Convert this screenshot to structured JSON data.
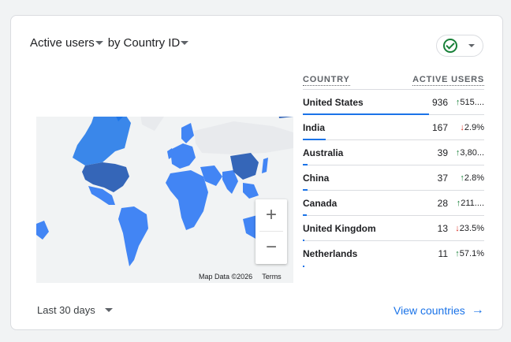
{
  "header": {
    "metric_label": "Active users",
    "dimension_prefix": "by",
    "dimension_label": "Country ID"
  },
  "status_chip": {
    "icon": "check-circle-icon",
    "color": "#188038"
  },
  "map": {
    "attribution": "Map Data ©2026",
    "terms": "Terms",
    "zoom_in": "+",
    "zoom_out": "−"
  },
  "table": {
    "col_country": "COUNTRY",
    "col_active_users": "ACTIVE USERS",
    "rows": [
      {
        "country": "United States",
        "value": "936",
        "change": "515....",
        "direction": "up",
        "share": 1.0
      },
      {
        "country": "India",
        "value": "167",
        "change": "2.9%",
        "direction": "down",
        "share": 0.18
      },
      {
        "country": "Australia",
        "value": "39",
        "change": "3,80...",
        "direction": "up",
        "share": 0.04
      },
      {
        "country": "China",
        "value": "37",
        "change": "2.8%",
        "direction": "up",
        "share": 0.04
      },
      {
        "country": "Canada",
        "value": "28",
        "change": "211....",
        "direction": "up",
        "share": 0.03
      },
      {
        "country": "United Kingdom",
        "value": "13",
        "change": "23.5%",
        "direction": "down",
        "share": 0.014
      },
      {
        "country": "Netherlands",
        "value": "11",
        "change": "57.1%",
        "direction": "up",
        "share": 0.012
      }
    ]
  },
  "footer": {
    "date_range": "Last 30 days",
    "view_link": "View countries"
  },
  "colors": {
    "accent": "#1a73e8",
    "up": "#188038",
    "down": "#d93025"
  }
}
